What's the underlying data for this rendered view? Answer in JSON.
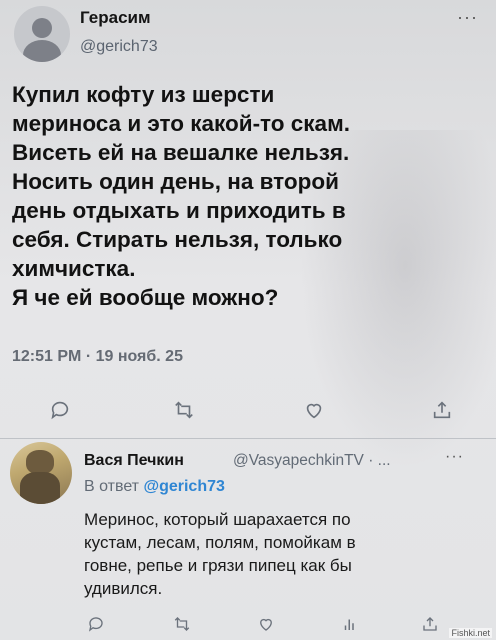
{
  "tweet": {
    "author_name": "Герасим",
    "author_handle": "@gerich73",
    "more": "···",
    "text_lines": [
      "Купил кофту из шерсти",
      "мериноса и это какой-то скам.",
      "Висеть ей на вешалке нельзя.",
      "Носить один день, на второй",
      "день отдыхать и приходить в",
      "себя. Стирать нельзя, только",
      "химчистка.",
      "Я че ей вообще можно?"
    ],
    "timestamp": "12:51 PM · 19 нояб. 25",
    "actions": [
      "reply-icon",
      "retweet-icon",
      "like-icon",
      "share-icon"
    ]
  },
  "reply": {
    "author_name": "Вася Печкин",
    "author_handle": "@VasyapechkinTV · ...",
    "more": "···",
    "reply_to_prefix": "В ответ",
    "reply_to_handle": "@gerich73",
    "text_lines": [
      "Меринос, который шарахается по",
      "кустам, лесам, полям, помойкам в",
      "говне, репье и грязи пипец как бы",
      "удивился."
    ],
    "actions": [
      "reply-icon",
      "retweet-icon",
      "like-icon",
      "views-icon",
      "share-icon"
    ]
  },
  "watermark": "Fishki.net",
  "colors": {
    "mention": "#2f86d3",
    "secondary_text": "#626b76",
    "background": "#dfe0e2"
  }
}
